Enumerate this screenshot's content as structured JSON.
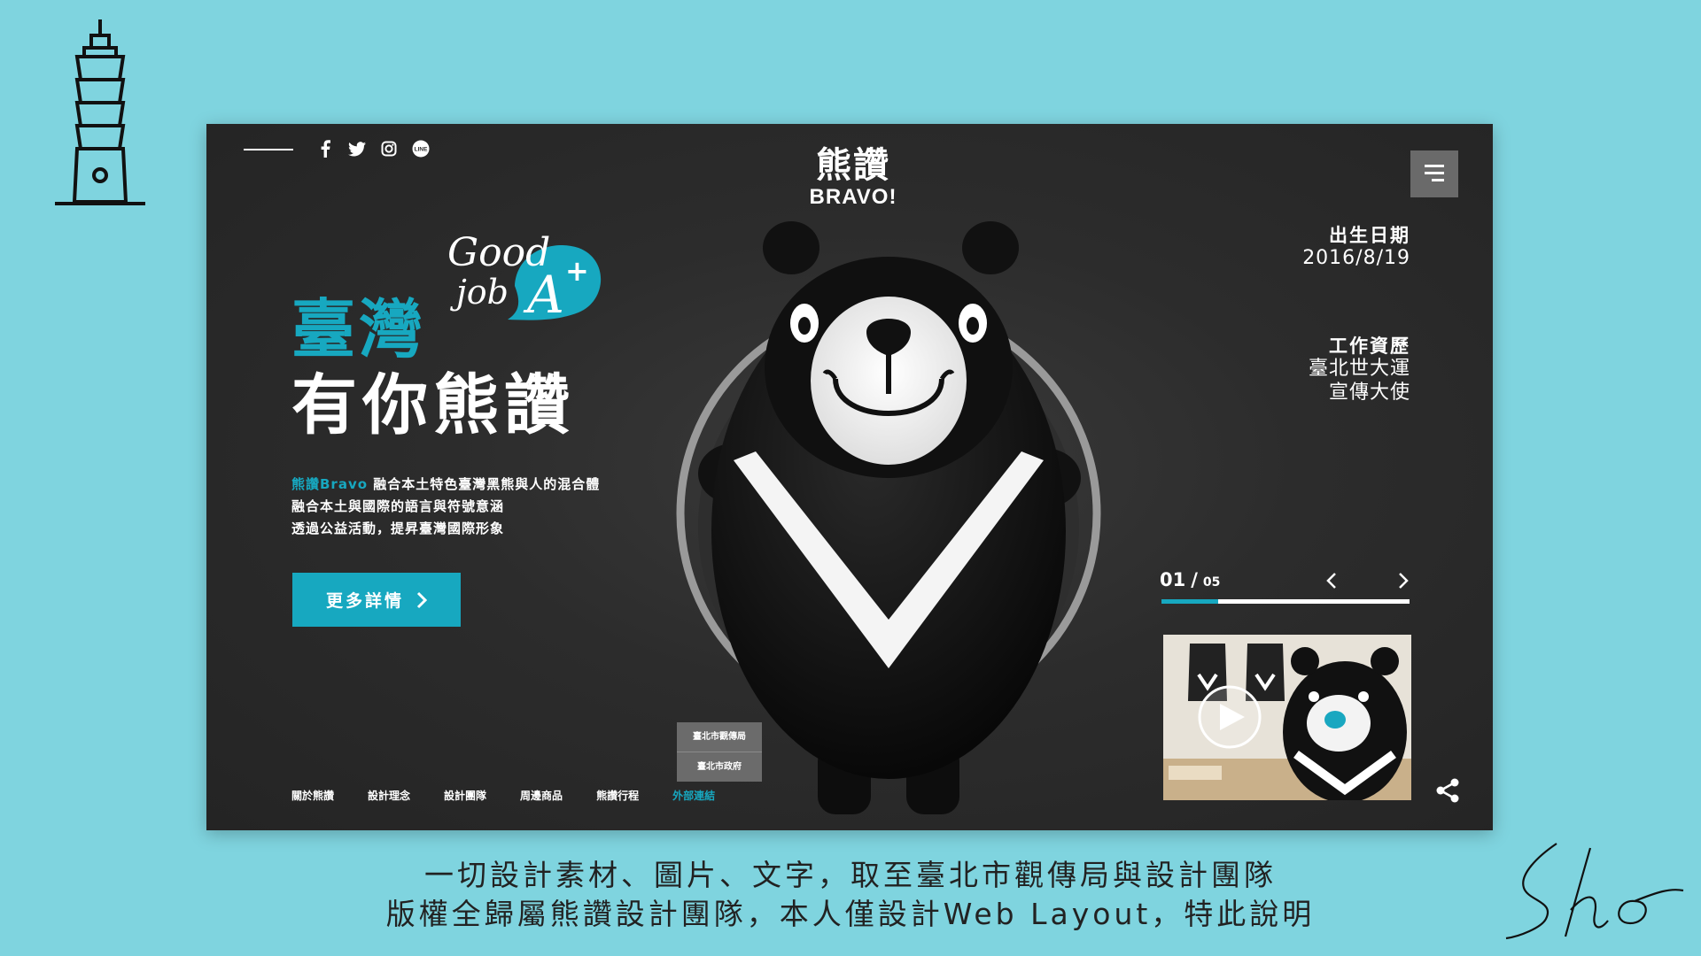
{
  "page": {
    "background": "#7fd4df",
    "accent": "#17a8c0"
  },
  "decor": {
    "tower_icon": "taipei-101-icon"
  },
  "header": {
    "social": [
      "facebook-icon",
      "twitter-icon",
      "instagram-icon",
      "line-icon"
    ],
    "logo_cn": "熊讚",
    "logo_en": "BRAVO!",
    "menu_icon": "menu-icon"
  },
  "hero": {
    "badge": "Good job A+",
    "title_teal": "臺灣",
    "title_white": "有你熊讚",
    "desc_highlight": "熊讚Bravo",
    "desc_line1": " 融合本土特色臺灣黑熊與人的混合體",
    "desc_line2": "融合本土與國際的語言與符號意涵",
    "desc_line3": "透過公益活動，提昇臺灣國際形象",
    "more_button": "更多詳情"
  },
  "profile": {
    "birth_label": "出生日期",
    "birth_value": "2016/8/19",
    "work_label": "工作資歷",
    "work_line1": "臺北世大運",
    "work_line2": "宣傳大使"
  },
  "slider": {
    "current": "01",
    "separator": "/",
    "total": "05",
    "progress": 0.23
  },
  "external_links": [
    "臺北市觀傳局",
    "臺北市政府"
  ],
  "nav": [
    "關於熊讚",
    "設計理念",
    "設計團隊",
    "周邊商品",
    "熊讚行程",
    "外部連結"
  ],
  "nav_active_index": 5,
  "caption": {
    "line1": "一切設計素材、圖片、文字，取至臺北市觀傳局與設計團隊",
    "line2": "版權全歸屬熊讚設計團隊，本人僅設計Web Layout，特此說明"
  }
}
